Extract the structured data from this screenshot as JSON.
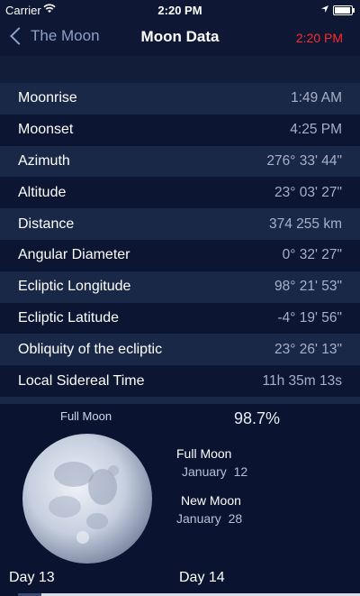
{
  "status_bar": {
    "carrier": "Carrier",
    "time": "2:20 PM"
  },
  "nav": {
    "back_label": "The Moon",
    "title": "Moon Data",
    "current_time": "2:20 PM",
    "current_time_color": "#ff2a2a"
  },
  "rows": [
    {
      "label": "Moonrise",
      "value": "1:49 AM"
    },
    {
      "label": "Moonset",
      "value": "4:25 PM"
    },
    {
      "label": "Azimuth",
      "value": "276° 33' 44\""
    },
    {
      "label": "Altitude",
      "value": "23° 03' 27\""
    },
    {
      "label": "Distance",
      "value": "374 255 km"
    },
    {
      "label": "Angular Diameter",
      "value": "0° 32' 27\""
    },
    {
      "label": "Ecliptic Longitude",
      "value": "98° 21' 53\""
    },
    {
      "label": "Ecliptic Latitude",
      "value": "-4° 19' 56\""
    },
    {
      "label": "Obliquity of the ecliptic",
      "value": "23° 26' 13\""
    },
    {
      "label": "Local Sidereal Time",
      "value": "11h 35m 13s"
    }
  ],
  "moon": {
    "phase_name": "Full Moon",
    "illumination": "98.7%",
    "illumination_fraction": 0.987,
    "next_phases": [
      {
        "name": "Full Moon",
        "date": "January  12"
      },
      {
        "name": "New Moon",
        "date": "January  28"
      }
    ]
  },
  "timeline": {
    "day_left": "Day 13",
    "day_right": "Day 14"
  },
  "colors": {
    "background": "#0a1330",
    "row_light": "#1a2848",
    "row_dark": "#0c1532",
    "accent_red": "#ff2a2a"
  }
}
